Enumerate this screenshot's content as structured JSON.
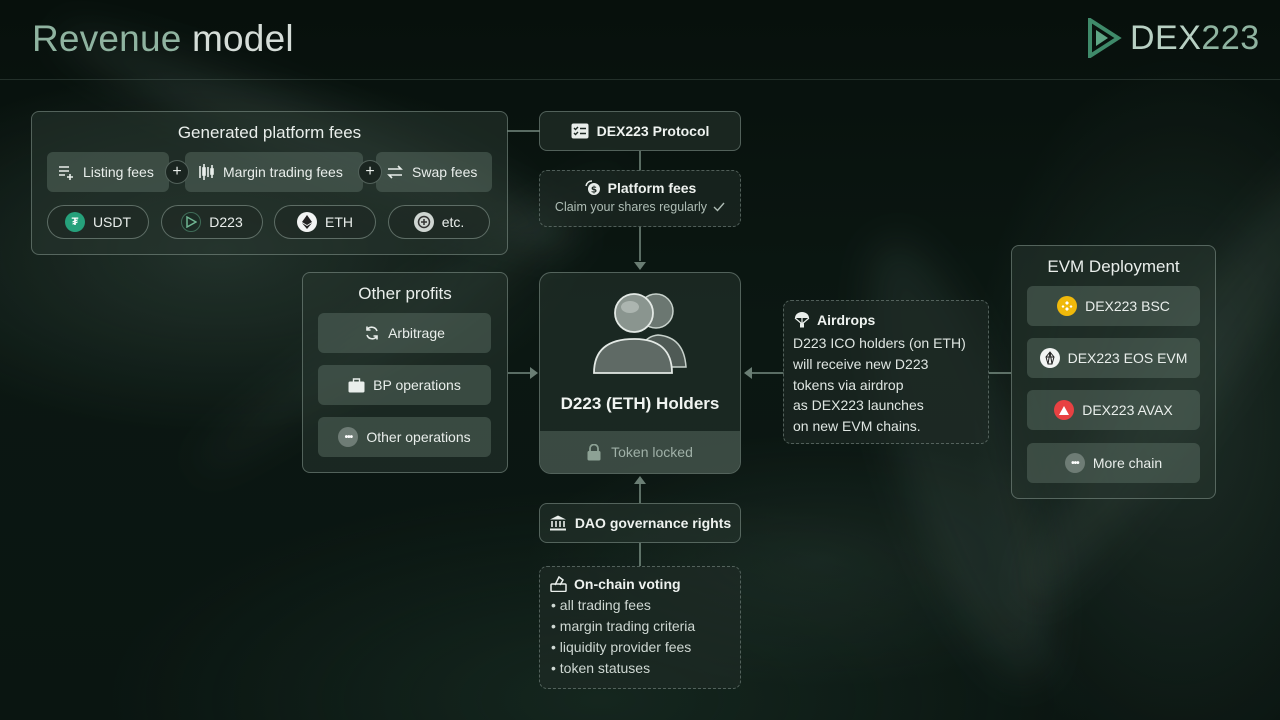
{
  "title": {
    "part1": "Revenue",
    "part2": "model"
  },
  "logo": {
    "name": "DEX",
    "number": "223"
  },
  "colors": {
    "accent": "#8fb3a0",
    "usdt": "#26a17b",
    "bsc": "#f0b90b",
    "avax": "#e84142"
  },
  "fees": {
    "title": "Generated platform fees",
    "types": [
      {
        "label": "Listing fees",
        "icon": "list-add-icon"
      },
      {
        "label": "Margin trading fees",
        "icon": "candlestick-icon"
      },
      {
        "label": "Swap fees",
        "icon": "swap-arrows-icon"
      }
    ],
    "plus": "+",
    "tokens": [
      {
        "label": "USDT",
        "icon": "tether-icon"
      },
      {
        "label": "D223",
        "icon": "d223-icon"
      },
      {
        "label": "ETH",
        "icon": "ethereum-icon"
      },
      {
        "label": "etc.",
        "icon": "more-coins-icon"
      }
    ]
  },
  "protocol": {
    "label": "DEX223 Protocol",
    "icon": "checklist-icon"
  },
  "platform_fees": {
    "title": "Platform fees",
    "subtitle": "Claim your shares regularly",
    "icon": "coin-claim-icon",
    "check_icon": "checkmark-icon"
  },
  "other_profits": {
    "title": "Other profits",
    "items": [
      {
        "label": "Arbitrage",
        "icon": "refresh-icon"
      },
      {
        "label": "BP operations",
        "icon": "briefcase-icon"
      },
      {
        "label": "Other operations",
        "icon": "more-dots-icon"
      }
    ]
  },
  "holders": {
    "title": "D223 (ETH) Holders",
    "locked": "Token locked",
    "icon": "users-icon",
    "lock_icon": "lock-icon"
  },
  "airdrops": {
    "title": "Airdrops",
    "icon": "parachute-icon",
    "lines": [
      "D223 ICO holders (on ETH)",
      "will receive new D223",
      "tokens via airdrop",
      "as DEX223 launches",
      "on new EVM chains."
    ]
  },
  "evm": {
    "title": "EVM Deployment",
    "items": [
      {
        "label": "DEX223 BSC",
        "icon": "bsc-icon"
      },
      {
        "label": "DEX223 EOS EVM",
        "icon": "eos-icon"
      },
      {
        "label": "DEX223 AVAX",
        "icon": "avax-icon"
      },
      {
        "label": "More chain",
        "icon": "more-dots-icon"
      }
    ]
  },
  "dao": {
    "label": "DAO governance rights",
    "icon": "bank-icon"
  },
  "voting": {
    "title": "On-chain voting",
    "icon": "ballot-icon",
    "items": [
      "all trading fees",
      "margin trading criteria",
      "liquidity provider fees",
      "token statuses"
    ]
  }
}
